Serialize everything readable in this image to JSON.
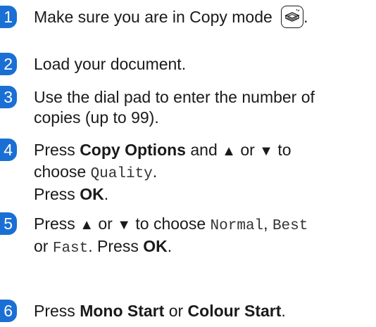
{
  "colors": {
    "badge": "#1a6fd4",
    "text": "#1a1a1a"
  },
  "steps": [
    {
      "number": "1",
      "pre": "Make sure you are in Copy mode",
      "icon": "copy-mode-icon",
      "post": "."
    },
    {
      "number": "2",
      "text": "Load your document."
    },
    {
      "number": "3",
      "line1": "Use the dial pad to enter the number of",
      "line2": "copies (up to 99)."
    },
    {
      "number": "4",
      "press": "Press",
      "copy_options": "Copy Options",
      "and": "and",
      "up": "▲",
      "or": "or",
      "down": "▼",
      "to": "to",
      "choose": "choose",
      "quality": "Quality",
      "period": ".",
      "press2": "Press",
      "ok": "OK",
      "period2": "."
    },
    {
      "number": "5",
      "press": "Press",
      "up": "▲",
      "or": "or",
      "down": "▼",
      "to_choose": "to choose",
      "normal": "Normal",
      "comma": ",",
      "best": "Best",
      "or2": "or",
      "fast": "Fast",
      "period": ".",
      "press2": "Press",
      "ok": "OK",
      "period2": "."
    },
    {
      "number": "6",
      "press": "Press",
      "mono_start": "Mono Start",
      "or": "or",
      "colour_start": "Colour Start",
      "period": "."
    }
  ]
}
